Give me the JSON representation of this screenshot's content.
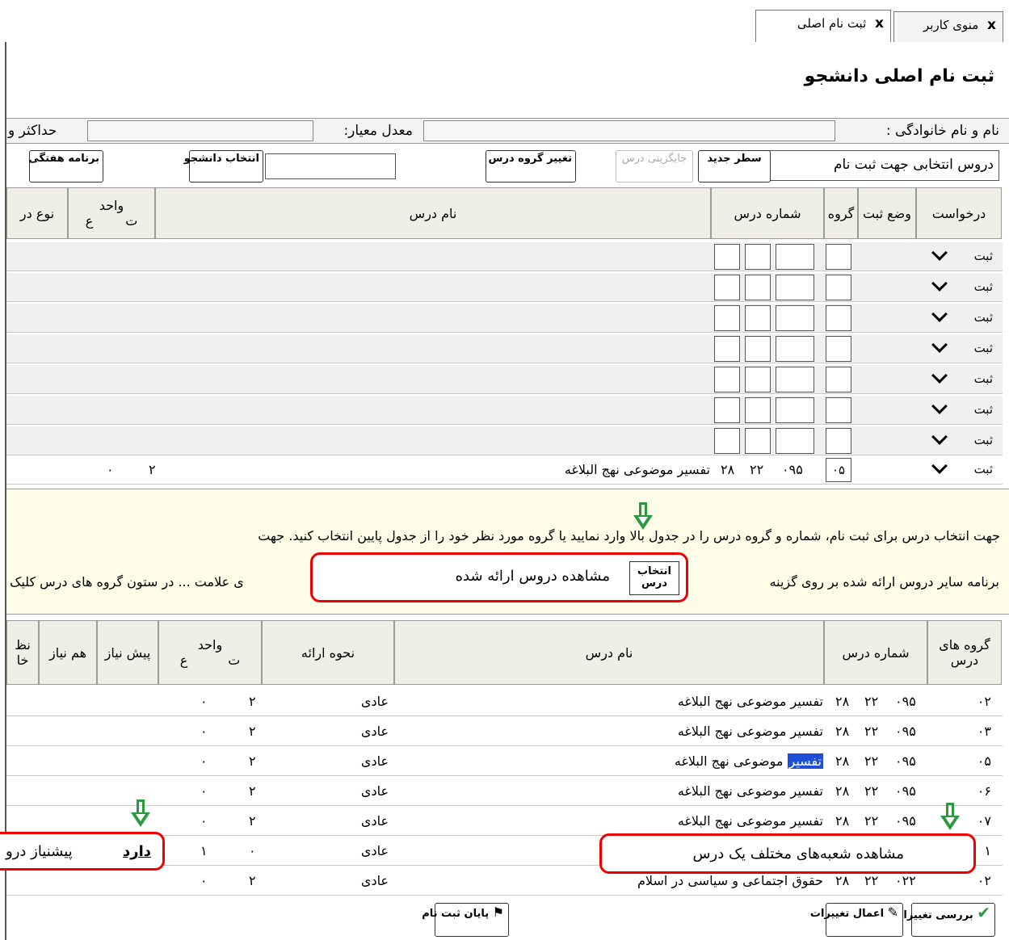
{
  "tabs": [
    {
      "label": "منوی کاربر",
      "close": "x"
    },
    {
      "label": "ثبت نام اصلی",
      "close": "x"
    }
  ],
  "page_title": "ثبت نام اصلی دانشجو",
  "info": {
    "name_label": "نام و نام خانوادگی :",
    "gpa_label": "معدل معیار:",
    "max_label": "حداکثر و"
  },
  "toolbar": {
    "selected_courses_label": "دروس انتخابی جهت ثبت نام",
    "new_row": "سطر جدید",
    "replace": "جایگزینی درس",
    "change_group": "تغییر گروه درس",
    "select_student": "انتخاب دانشجو",
    "weekly_program": "برنامه هفتگی"
  },
  "top_table": {
    "headers": {
      "request": "درخواست",
      "status": "وضع ثبت",
      "group": "گروه",
      "course_number": "شماره درس",
      "course_name": "نام درس",
      "units": "واحد",
      "units_t": "ت",
      "units_a": "ع",
      "course_type": "نوع در"
    },
    "empty_rows": [
      "ثبت",
      "ثبت",
      "ثبت",
      "ثبت",
      "ثبت",
      "ثبت",
      "ثبت"
    ],
    "filled_row": {
      "request": "ثبت",
      "group": "۰۵",
      "num1": "۰۹۵",
      "num2": "۲۲",
      "num3": "۲۸",
      "name": "تفسیر موضوعی نهج البلاغه",
      "t": "۲",
      "a": "۰"
    }
  },
  "message": {
    "line1": "جهت انتخاب درس برای ثبت نام، شماره و گروه درس را در جدول بالا وارد نمایید یا گروه مورد نظر خود را از جدول پایین انتخاب کنید. جهت",
    "line2_right": "برنامه سایر دروس ارائه شده بر روی گزینه",
    "line2_left": "ی علامت ... در ستون گروه های درس کلیک"
  },
  "callouts": {
    "offered": "مشاهده دروس ارائه شده",
    "offered_icon_label": "انتخاب درس",
    "sections": "مشاهده شعبه‌های مختلف یک درس",
    "prereq": "پیشنیاز درو"
  },
  "bottom_table": {
    "headers": {
      "groups": "گروه های درس",
      "course_number": "شماره درس",
      "course_name": "نام درس",
      "delivery": "نحوه ارائه",
      "units": "واحد",
      "units_t": "ت",
      "units_a": "ع",
      "prereq": "پیش نیاز",
      "coreq": "هم نیاز",
      "extra": "نظ خا"
    },
    "rows": [
      {
        "group": "۰۲",
        "n1": "۰۹۵",
        "n2": "۲۲",
        "n3": "۲۸",
        "name": "تفسیر موضوعی نهج البلاغه",
        "delivery": "عادی",
        "t": "۲",
        "a": "۰",
        "prereq": ""
      },
      {
        "group": "۰۳",
        "n1": "۰۹۵",
        "n2": "۲۲",
        "n3": "۲۸",
        "name": "تفسیر موضوعی نهج البلاغه",
        "delivery": "عادی",
        "t": "۲",
        "a": "۰",
        "prereq": ""
      },
      {
        "group": "۰۵",
        "n1": "۰۹۵",
        "n2": "۲۲",
        "n3": "۲۸",
        "name_hl": "تفسیر",
        "name_rest": "موضوعی نهج البلاغه",
        "delivery": "عادی",
        "t": "۲",
        "a": "۰",
        "prereq": ""
      },
      {
        "group": "۰۶",
        "n1": "۰۹۵",
        "n2": "۲۲",
        "n3": "۲۸",
        "name": "تفسیر موضوعی نهج البلاغه",
        "delivery": "عادی",
        "t": "۲",
        "a": "۰",
        "prereq": ""
      },
      {
        "group": "۰۷",
        "n1": "۰۹۵",
        "n2": "۲۲",
        "n3": "۲۸",
        "name": "تفسیر موضوعی نهج البلاغه",
        "delivery": "عادی",
        "t": "۲",
        "a": "۰",
        "prereq": ""
      },
      {
        "group": "۱",
        "dots": "...",
        "delivery": "عادی",
        "t": "۰",
        "a": "۱",
        "prereq": "دارد"
      },
      {
        "group": "۰۲",
        "n1": "۰۲۲",
        "n2": "۲۲",
        "n3": "۲۸",
        "name": "حقوق اجتماعی و سیاسی در اسلام",
        "delivery": "عادی",
        "t": "۲",
        "a": "۰",
        "prereq": ""
      }
    ]
  },
  "bottom_buttons": {
    "review": "بررسی تغییرات",
    "apply": "اعمال تغییرات",
    "finish": "پایان ثبت نام"
  },
  "colors": {
    "highlight": "#1f4fd8",
    "callout": "#e00000",
    "arrow": "#2a9a40"
  }
}
